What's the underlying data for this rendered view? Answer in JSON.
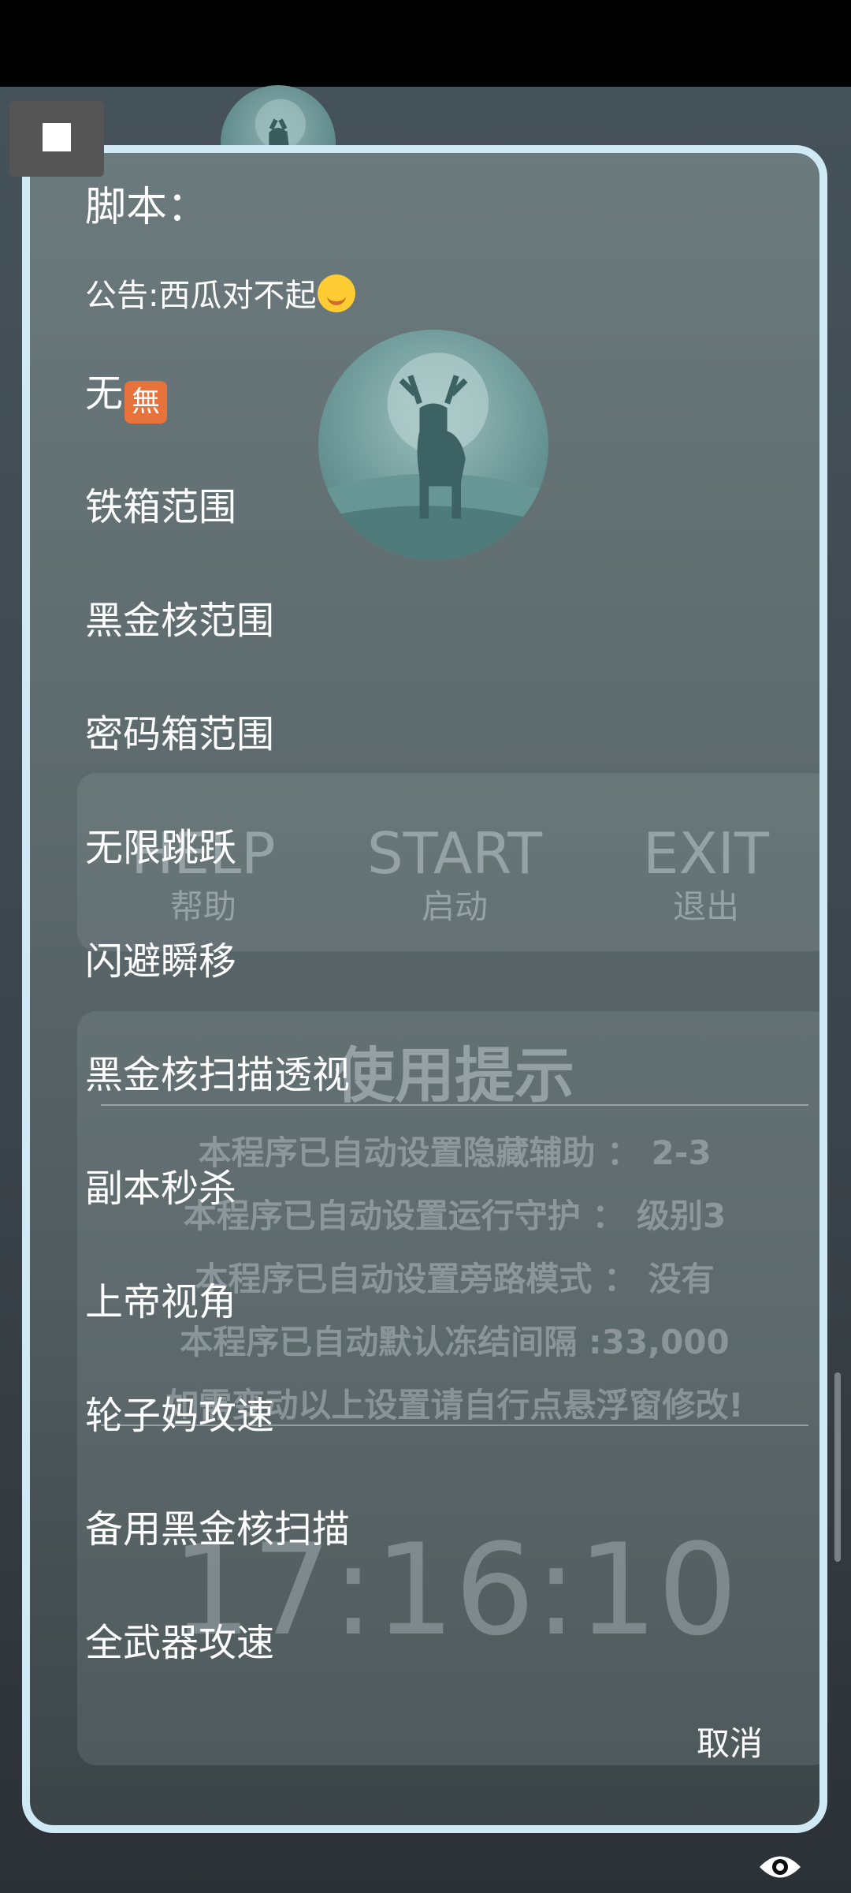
{
  "dialog": {
    "title": "脚本：",
    "notice_text": "公告:西瓜对不起",
    "items": [
      {
        "label": "无",
        "badge": "無"
      },
      {
        "label": "铁箱范围"
      },
      {
        "label": "黑金核范围"
      },
      {
        "label": "密码箱范围"
      },
      {
        "label": "无限跳跃"
      },
      {
        "label": "闪避瞬移"
      },
      {
        "label": "黑金核扫描透视"
      },
      {
        "label": "副本秒杀"
      },
      {
        "label": "上帝视角"
      },
      {
        "label": "轮子妈攻速"
      },
      {
        "label": "备用黑金核扫描"
      },
      {
        "label": "全武器攻速"
      }
    ],
    "cancel_label": "取消"
  },
  "background": {
    "buttons": [
      {
        "en": "HELP",
        "zh": "帮助"
      },
      {
        "en": "START",
        "zh": "启动"
      },
      {
        "en": "EXIT",
        "zh": "退出"
      }
    ],
    "tips_title": "使用提示",
    "tips": [
      "本程序已自动设置隐藏辅助 ： 2-3",
      "本程序已自动设置运行守护 ： 级别3",
      "本程序已自动设置旁路模式 ： 没有",
      "本程序已自动默认冻结间隔 :33,000",
      "如需变动以上设置请自行点悬浮窗修改!"
    ],
    "clock": "17:16:10"
  },
  "colors": {
    "dialog_border": "#cfe9f5",
    "badge": "#e8723c"
  },
  "icons": {
    "floating": "square-stop-icon",
    "visibility": "eye-icon"
  }
}
